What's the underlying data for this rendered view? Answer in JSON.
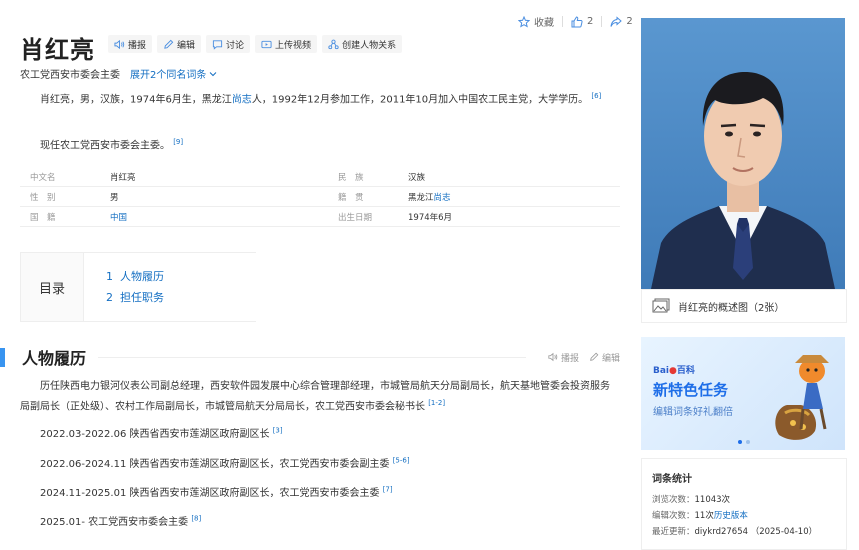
{
  "actions": {
    "favorite_label": "收藏",
    "like_count": "2",
    "share_count": "2"
  },
  "title": "肖红亮",
  "toolbar": {
    "broadcast": "播报",
    "edit": "编辑",
    "discuss": "讨论",
    "upload_video": "上传视频",
    "create_relation": "创建人物关系"
  },
  "subtitle": {
    "text": "农工党西安市委会主委",
    "expand": "展开2个同名词条"
  },
  "intro": {
    "p1_a": "肖红亮，男，汉族，1974年6月生，黑龙江",
    "p1_link": "尚志",
    "p1_b": "人，1992年12月参加工作，2011年10月加入中国农工民主党，大学学历。",
    "p1_ref": "[6]",
    "p2": "现任农工党西安市委会主委。",
    "p2_ref": "[9]"
  },
  "info": {
    "rows": [
      {
        "k1": "中文名",
        "v1": "肖红亮",
        "k2": "民　族",
        "v2": "汉族"
      },
      {
        "k1": "性　别",
        "v1": "男",
        "k2": "籍　贯",
        "v2_a": "黑龙江",
        "v2_link": "尚志"
      },
      {
        "k1": "国　籍",
        "v1_link": "中国",
        "k2": "出生日期",
        "v2": "1974年6月"
      }
    ]
  },
  "toc": {
    "label": "目录",
    "items": [
      {
        "n": "1",
        "text": "人物履历"
      },
      {
        "n": "2",
        "text": "担任职务"
      }
    ]
  },
  "section": {
    "title": "人物履历",
    "broadcast": "播报",
    "edit": "编辑"
  },
  "career": {
    "summary": "历任陕西电力银河仪表公司副总经理，西安软件园发展中心综合管理部经理，市城管局航天分局副局长，航天基地管委会投资服务局副局长（正处级）、农村工作局副局长，市城管局航天分局局长，农工党西安市委会秘书长",
    "summary_ref": "[1-2]",
    "entries": [
      {
        "text": "2022.03-2022.06 陕西省西安市莲湖区政府副区长",
        "ref": "[3]"
      },
      {
        "text": "2022.06-2024.11 陕西省西安市莲湖区政府副区长，农工党西安市委会副主委",
        "ref": "[5-6]"
      },
      {
        "text": "2024.11-2025.01 陕西省西安市莲湖区政府副区长，农工党西安市委会主委",
        "ref": "[7]"
      },
      {
        "text": "2025.01- 农工党西安市委会主委",
        "ref": "[8]"
      }
    ]
  },
  "photo": {
    "caption": "肖红亮的概述图（2张）"
  },
  "banner": {
    "logo_a": "Bai",
    "logo_b": "百科",
    "title": "新特色任务",
    "subtitle": "编辑词条好礼翻倍"
  },
  "stats": {
    "title": "词条统计",
    "views_label": "浏览次数：",
    "views": "11043次",
    "edits_label": "编辑次数：",
    "edits": "11次",
    "history": "历史版本",
    "updated_label": "最近更新：",
    "updated": "diykrd27654 （2025-04-10）"
  },
  "colors": {
    "accent": "#136ec2",
    "section_bar": "#3894f0",
    "photo_bg": "#4a87c2"
  }
}
